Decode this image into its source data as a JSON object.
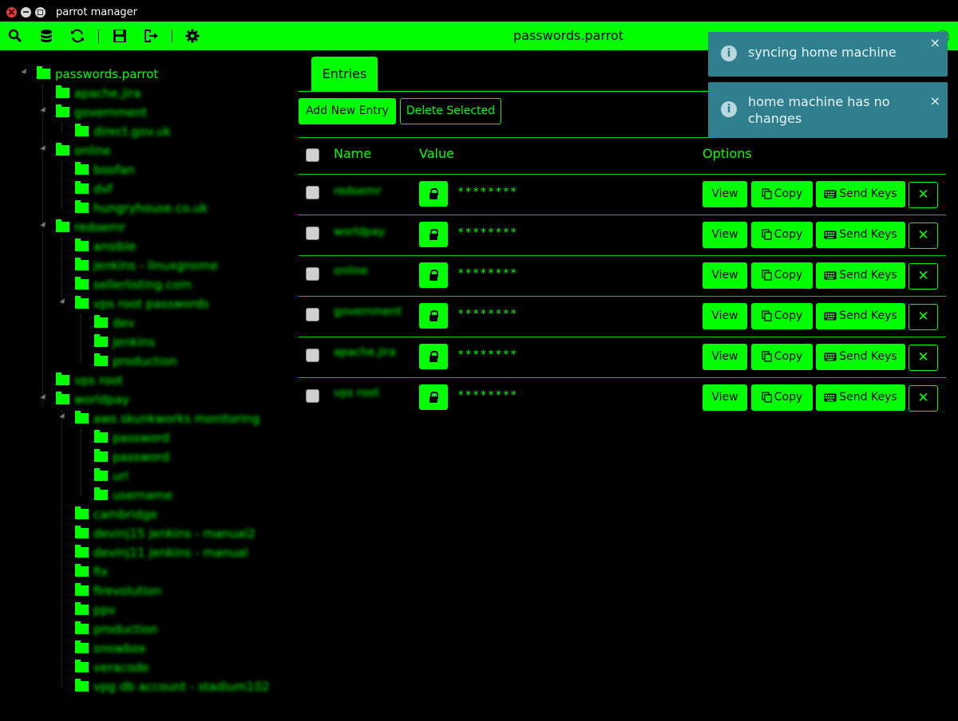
{
  "window": {
    "title": "parrot manager"
  },
  "toolbar": {
    "icons": [
      "search-icon",
      "database-icon",
      "refresh-icon",
      "save-icon",
      "export-icon",
      "gear-icon"
    ],
    "document_title": "passwords.parrot",
    "help_label": "?"
  },
  "tree": {
    "root": "passwords.parrot",
    "nodes": [
      "apache.jira",
      "government",
      "direct.gov.uk",
      "online",
      "boofan",
      "dvf",
      "hungryhouse.co.uk",
      "redoemr",
      "ansible",
      "jenkins - linuxgnome",
      "sellerlisting.com",
      "vps root passwords",
      "dev",
      "jenkins",
      "production",
      "vps root",
      "worldpay",
      "aws skunkworks monitoring",
      "password",
      "password",
      "url",
      "username",
      "cambridge",
      "devinj15 jenkins - manual2",
      "devinj11 jenkins - manual",
      "fix",
      "firevolution",
      "ppv",
      "production",
      "snowbox",
      "veracode",
      "vpg db account - stadium102"
    ]
  },
  "tabs": [
    {
      "label": "Entries"
    }
  ],
  "actions": {
    "add": "Add New Entry",
    "delete": "Delete Selected"
  },
  "table": {
    "headers": {
      "name": "Name",
      "value": "Value",
      "options": "Options"
    },
    "rows": [
      {
        "name": "redoemr",
        "value": "********"
      },
      {
        "name": "worldpay",
        "value": "********"
      },
      {
        "name": "online",
        "value": "********"
      },
      {
        "name": "government",
        "value": "********"
      },
      {
        "name": "apache.jira",
        "value": "********"
      },
      {
        "name": "vps root",
        "value": "********"
      }
    ],
    "row_buttons": {
      "view": "View",
      "copy": "Copy",
      "send_keys": "Send Keys",
      "remove": "✕"
    }
  },
  "notifications": [
    {
      "text": "syncing home machine",
      "close": "×"
    },
    {
      "text": "home machine has no changes",
      "close": "×"
    }
  ],
  "colors": {
    "accent": "#00ff00",
    "background": "#000000",
    "notification": "#2f7f8f"
  }
}
